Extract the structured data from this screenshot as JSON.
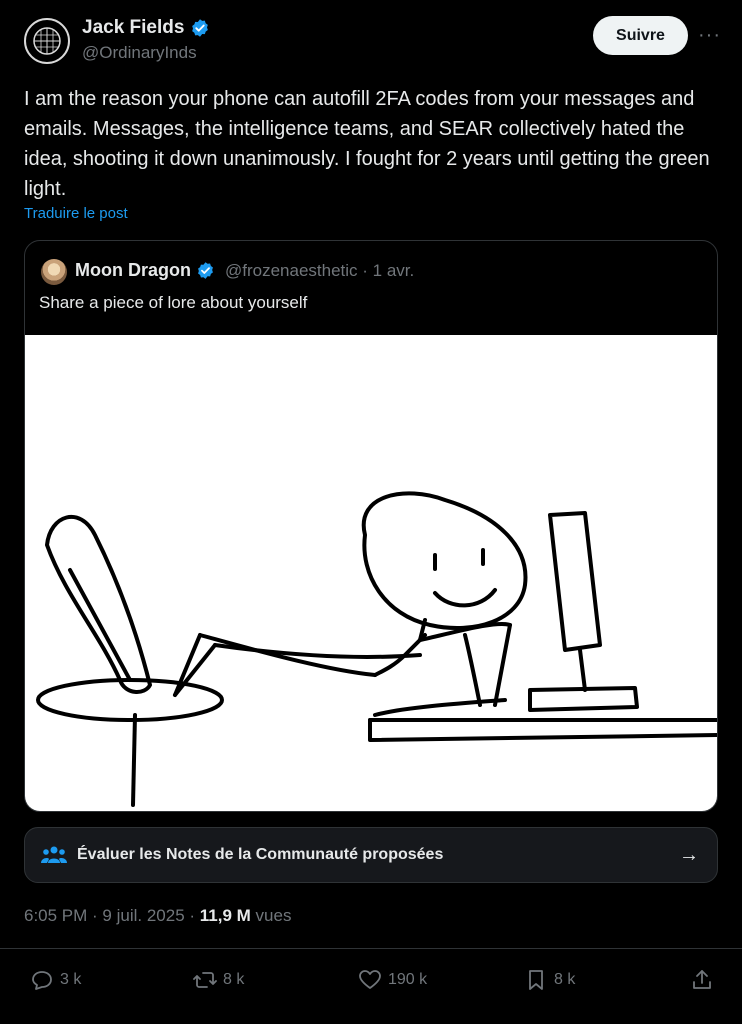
{
  "author": {
    "name": "Jack Fields",
    "handle": "@OrdinaryInds",
    "verified_icon": "verified-badge-icon"
  },
  "follow_button": "Suivre",
  "more_menu": "···",
  "post_text": "I am the reason your phone can autofill 2FA codes from your messages and emails. Messages, the intelligence teams, and SEAR collectively hated the idea, shooting it down unanimously. I fought for 2 years until getting the green light.",
  "translate_link": "Traduire le post",
  "quoted_post": {
    "name": "Moon Dragon",
    "meta": "@frozenaesthetic · 1 avr.",
    "text": "Share a piece of lore about yourself"
  },
  "community_notes": {
    "label": "Évaluer les Notes de la Communauté proposées",
    "arrow": "→"
  },
  "timestamp": "6:05 PM · 9 juil. 2025 · ",
  "views_count": "11,9 M",
  "views_label": " vues",
  "actions": {
    "replies": "3 k",
    "reposts": "8 k",
    "likes": "190 k",
    "bookmarks": "8 k"
  },
  "colors": {
    "accent": "#1d9bf0",
    "background": "#000000",
    "muted": "#71767b"
  }
}
